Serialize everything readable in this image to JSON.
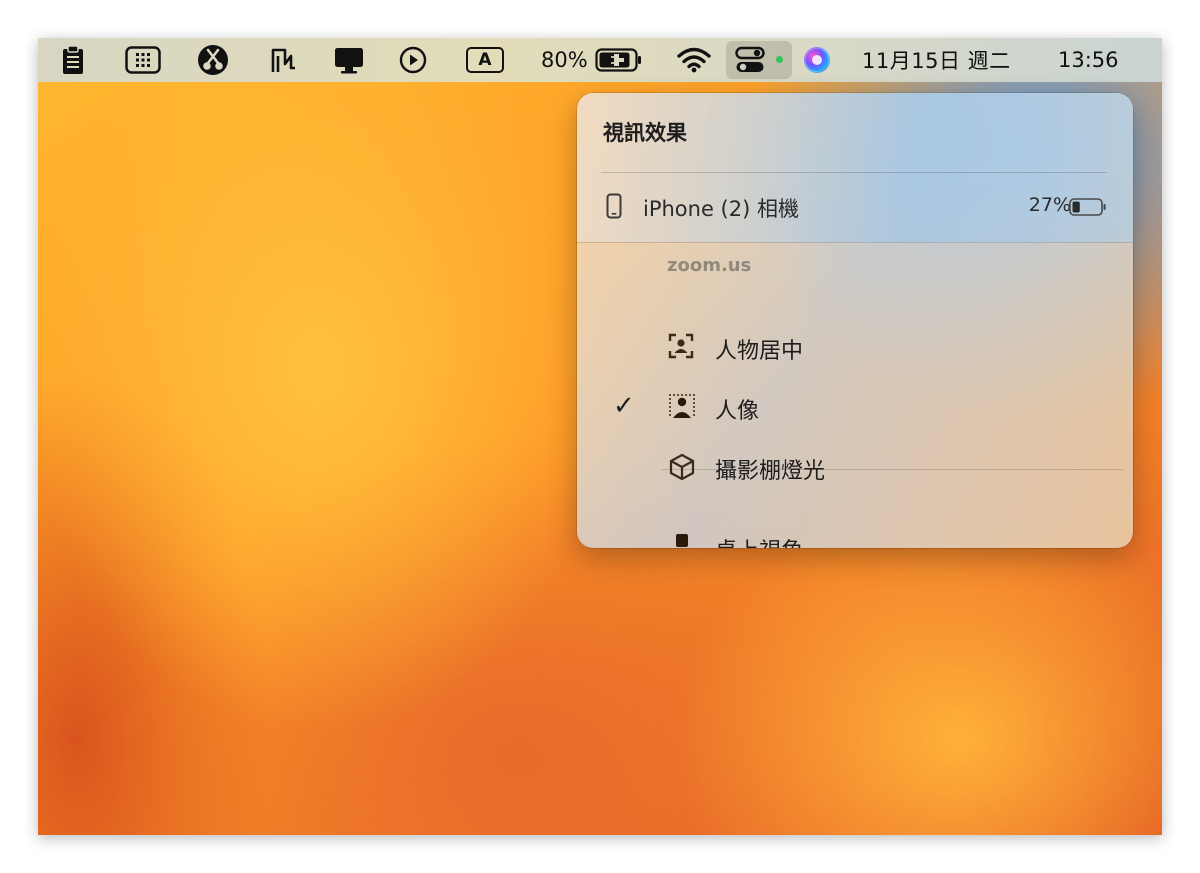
{
  "menubar": {
    "icons": [
      "clipboard-icon",
      "keypad-icon",
      "scissors-icon",
      "activity-monitor-icon",
      "display-icon",
      "play-icon",
      "input-source-icon",
      "wifi-icon",
      "control-center-icon",
      "siri-icon"
    ],
    "input_source_letter": "A",
    "battery_percent": "80%",
    "date": "11月15日 週二",
    "time": "13:56"
  },
  "popover": {
    "title": "視訊效果",
    "device": {
      "name": "iPhone (2) 相機",
      "battery_percent": "27%",
      "battery_level": 0.27
    },
    "section_label": "zoom.us",
    "items": [
      {
        "label": "人物居中",
        "icon": "center-stage-icon",
        "checked": false
      },
      {
        "label": "人像",
        "icon": "portrait-icon",
        "checked": true,
        "check_glyph": "✓"
      },
      {
        "label": "攝影棚燈光",
        "icon": "studio-light-icon",
        "checked": false
      },
      {
        "label": "桌上視角⋯",
        "icon": "desk-view-icon",
        "checked": false
      }
    ]
  }
}
